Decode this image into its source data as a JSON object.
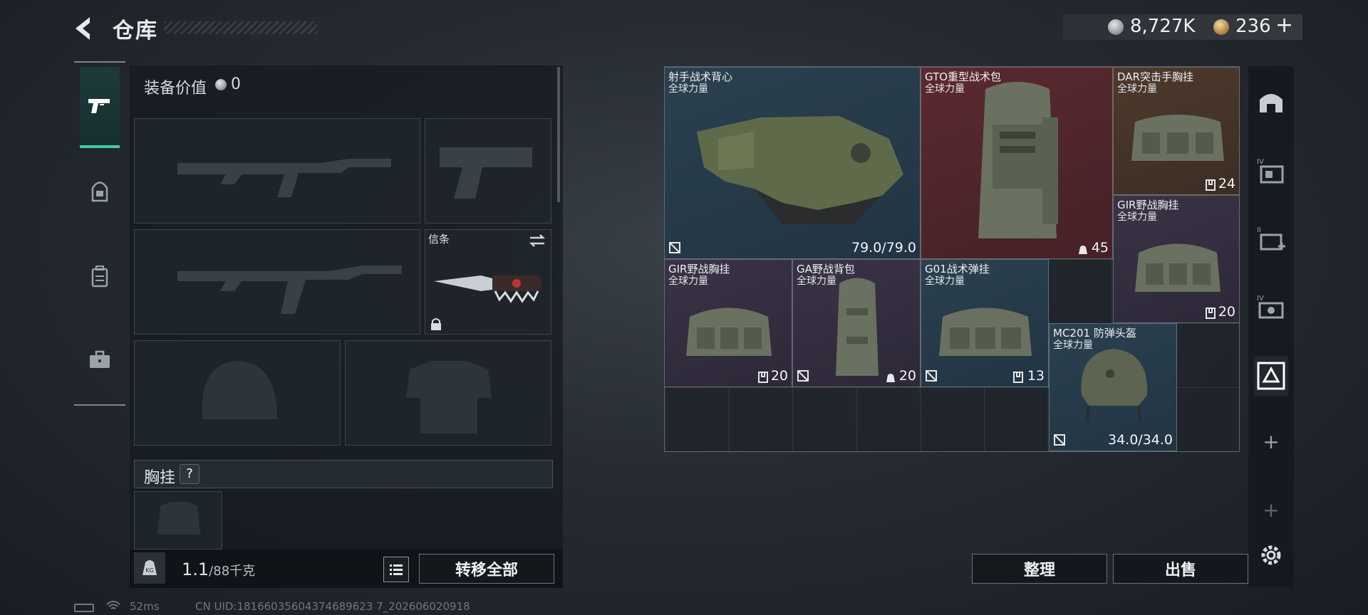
{
  "header": {
    "title": "仓库"
  },
  "currency": {
    "silver": "8,727K",
    "gold": "236",
    "gold_plus": "+"
  },
  "left_tabs": [
    {
      "name": "tab-weapons",
      "icon": "pistol-icon",
      "active": true
    },
    {
      "name": "tab-bag",
      "icon": "bag-icon",
      "active": false
    },
    {
      "name": "tab-backpack",
      "icon": "backpack-icon",
      "active": false
    },
    {
      "name": "tab-case",
      "icon": "briefcase-icon",
      "active": false
    }
  ],
  "loadout": {
    "equip_value_label": "装备价值",
    "equip_value": "0",
    "melee_label": "信条",
    "vest_section_label": "胸挂",
    "help": "?"
  },
  "weight": {
    "current": "1.1",
    "max": "/88千克"
  },
  "buttons": {
    "transfer_all": "转移全部",
    "organize": "整理",
    "sell": "出售"
  },
  "stash_items": [
    {
      "name": "射手战术背心",
      "brand": "全球力量",
      "stat": "79.0/79.0",
      "rarity": "blue",
      "flag": true
    },
    {
      "name": "GTO重型战术包",
      "brand": "全球力量",
      "stat": "45",
      "stat_icon": "weight-icon",
      "rarity": "red"
    },
    {
      "name": "DAR突击手胸挂",
      "brand": "全球力量",
      "stat": "24",
      "stat_icon": "slots-icon",
      "rarity": "orange"
    },
    {
      "name": "GIR野战胸挂",
      "brand": "全球力量",
      "stat": "20",
      "stat_icon": "slots-icon",
      "rarity": "purple"
    },
    {
      "name": "GIR野战胸挂",
      "brand": "全球力量",
      "stat": "20",
      "stat_icon": "slots-icon",
      "rarity": "purple"
    },
    {
      "name": "GA野战背包",
      "brand": "全球力量",
      "stat": "20",
      "stat_icon": "weight-icon",
      "rarity": "purple",
      "flag": true
    },
    {
      "name": "G01战术弹挂",
      "brand": "全球力量",
      "stat": "13",
      "stat_icon": "slots-icon",
      "rarity": "blue",
      "flag": true
    },
    {
      "name": "MC201 防弹头盔",
      "brand": "全球力量",
      "stat": "34.0/34.0",
      "rarity": "blue",
      "flag": true
    }
  ],
  "right_rail": [
    "helmet-slot-icon",
    "level-4-container-icon",
    "level-2-add-icon",
    "level-4-camera-icon",
    "container-selected-icon"
  ],
  "right_rail_plus": [
    "+",
    "+"
  ],
  "footer": {
    "ping": "52ms",
    "uid": "CN UID:18166035604374689623 7_202606020918"
  }
}
